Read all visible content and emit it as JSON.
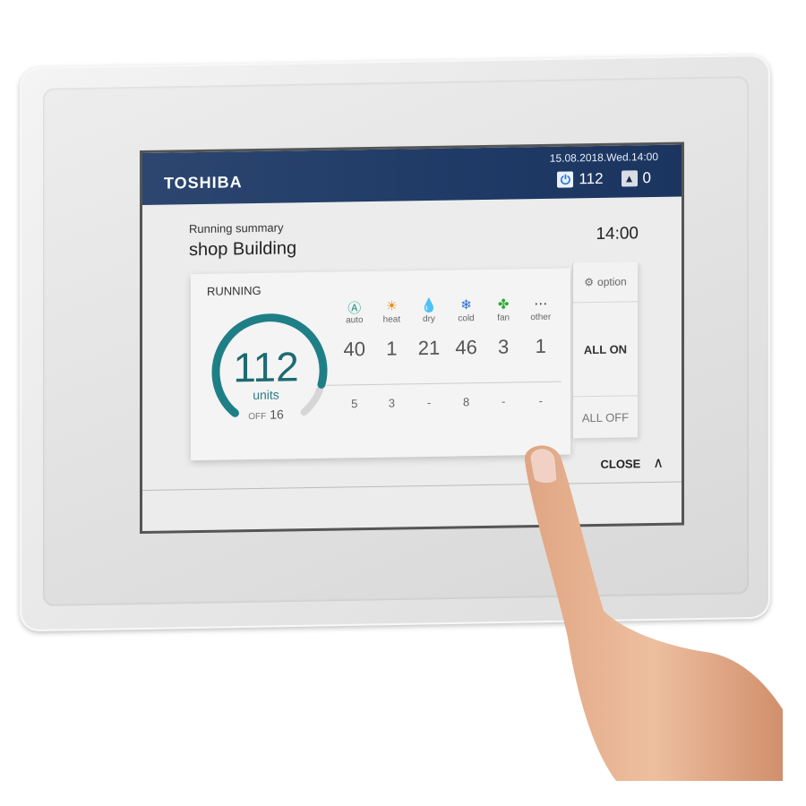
{
  "header": {
    "brand": "TOSHIBA",
    "datetime": "15.08.2018.Wed.14:00",
    "running_count": "112",
    "alarm_count": "0",
    "power_icon": "power-icon",
    "alarm_icon": "warning-icon"
  },
  "page": {
    "subtitle": "Running summary",
    "title": "shop Building",
    "clock": "14:00"
  },
  "summary": {
    "status_label": "RUNNING",
    "running_units": "112",
    "units_label": "units",
    "off_label": "OFF",
    "off_count": "16",
    "running_fraction": 0.875,
    "accent_color": "#1f7f86",
    "modes": [
      {
        "icon": "auto-icon",
        "glyph": "Ⓐ",
        "color": "#1f9a8a",
        "label": "auto",
        "count": "40",
        "sub": "5"
      },
      {
        "icon": "sun-icon",
        "glyph": "☀",
        "color": "#e8901c",
        "label": "heat",
        "count": "1",
        "sub": "3"
      },
      {
        "icon": "droplet-icon",
        "glyph": "💧",
        "color": "#2aa7c7",
        "label": "dry",
        "count": "21",
        "sub": "-"
      },
      {
        "icon": "snowflake-icon",
        "glyph": "❄",
        "color": "#2a6fd6",
        "label": "cold",
        "count": "46",
        "sub": "8"
      },
      {
        "icon": "fan-icon",
        "glyph": "✤",
        "color": "#2fa83a",
        "label": "fan",
        "count": "3",
        "sub": "-"
      },
      {
        "icon": "more-icon",
        "glyph": "⋯",
        "color": "#333333",
        "label": "other",
        "count": "1",
        "sub": "-"
      }
    ]
  },
  "actions": {
    "option_label": "option",
    "all_on_label": "ALL ON",
    "all_off_label": "ALL OFF",
    "close_label": "CLOSE"
  }
}
